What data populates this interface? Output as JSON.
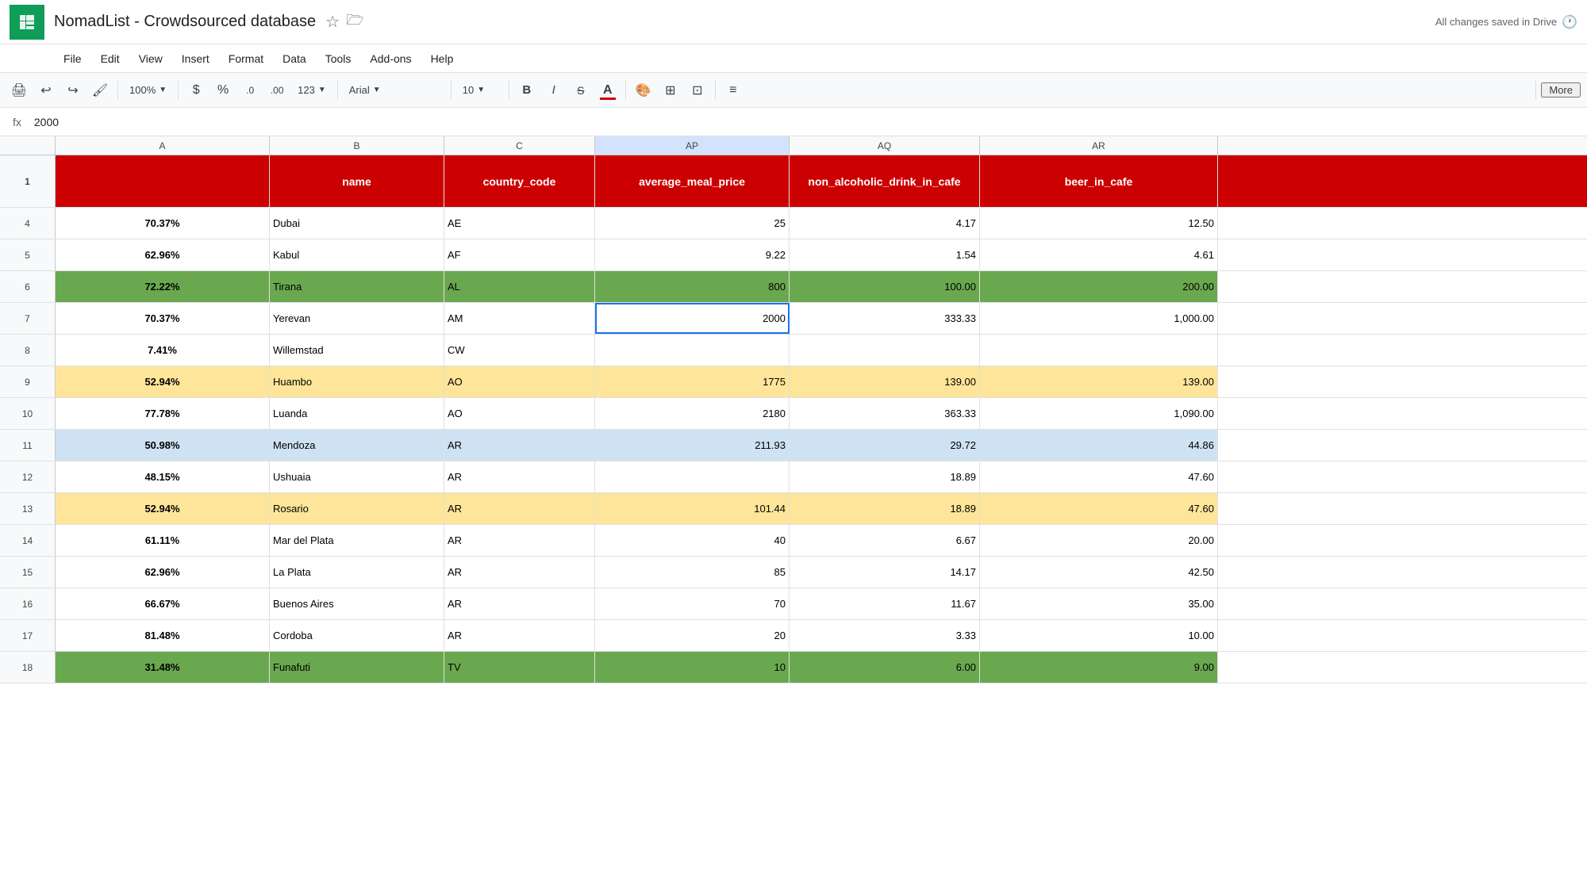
{
  "app": {
    "icon_label": "sheets-icon",
    "title": "NomadList - Crowdsourced database",
    "star_icon": "★",
    "folder_icon": "🗀",
    "autosave": "All changes saved in Drive"
  },
  "menu": {
    "items": [
      "File",
      "Edit",
      "View",
      "Insert",
      "Format",
      "Data",
      "Tools",
      "Add-ons",
      "Help"
    ]
  },
  "toolbar": {
    "zoom": "100%",
    "currency": "$",
    "percent": "%",
    "decimal_less": ".0",
    "decimal_more": ".00",
    "number_format": "123",
    "font": "Arial",
    "font_size": "10",
    "more_label": "More"
  },
  "formula_bar": {
    "fx": "fx",
    "value": "2000"
  },
  "columns": {
    "headers": [
      "A",
      "B",
      "C",
      "AP",
      "AQ",
      "AR"
    ],
    "widths": [
      270,
      220,
      190,
      245,
      240,
      300
    ],
    "col_A_label": "A",
    "col_B_label": "B",
    "col_C_label": "C",
    "col_AP_label": "AP",
    "col_AQ_label": "AQ",
    "col_AR_label": "AR"
  },
  "header_row": {
    "row_num": "1",
    "col_b": "name",
    "col_c": "country_code",
    "col_ap": "average_meal_price",
    "col_aq": "non_alcoholic_drink_in_cafe",
    "col_ar": "beer_in_cafe"
  },
  "rows": [
    {
      "num": "4",
      "col_a": "70.37%",
      "col_b": "Dubai",
      "col_c": "AE",
      "col_ap": "25",
      "col_aq": "4.17",
      "col_ar": "12.50",
      "row_color": "white"
    },
    {
      "num": "5",
      "col_a": "62.96%",
      "col_b": "Kabul",
      "col_c": "AF",
      "col_ap": "9.22",
      "col_aq": "1.54",
      "col_ar": "4.61",
      "row_color": "white"
    },
    {
      "num": "6",
      "col_a": "72.22%",
      "col_b": "Tirana",
      "col_c": "AL",
      "col_ap": "800",
      "col_aq": "100.00",
      "col_ar": "200.00",
      "row_color": "green"
    },
    {
      "num": "7",
      "col_a": "70.37%",
      "col_b": "Yerevan",
      "col_c": "AM",
      "col_ap": "2000",
      "col_aq": "333.33",
      "col_ar": "1,000.00",
      "row_color": "white",
      "active_ap": true
    },
    {
      "num": "8",
      "col_a": "7.41%",
      "col_b": "Willemstad",
      "col_c": "CW",
      "col_ap": "",
      "col_aq": "",
      "col_ar": "",
      "row_color": "white"
    },
    {
      "num": "9",
      "col_a": "52.94%",
      "col_b": "Huambo",
      "col_c": "AO",
      "col_ap": "1775",
      "col_aq": "139.00",
      "col_ar": "139.00",
      "row_color": "yellow"
    },
    {
      "num": "10",
      "col_a": "77.78%",
      "col_b": "Luanda",
      "col_c": "AO",
      "col_ap": "2180",
      "col_aq": "363.33",
      "col_ar": "1,090.00",
      "row_color": "white"
    },
    {
      "num": "11",
      "col_a": "50.98%",
      "col_b": "Mendoza",
      "col_c": "AR",
      "col_ap": "211.93",
      "col_aq": "29.72",
      "col_ar": "44.86",
      "row_color": "blue"
    },
    {
      "num": "12",
      "col_a": "48.15%",
      "col_b": "Ushuaia",
      "col_c": "AR",
      "col_ap": "",
      "col_aq": "18.89",
      "col_ar": "47.60",
      "row_color": "white"
    },
    {
      "num": "13",
      "col_a": "52.94%",
      "col_b": "Rosario",
      "col_c": "AR",
      "col_ap": "101.44",
      "col_aq": "18.89",
      "col_ar": "47.60",
      "row_color": "yellow"
    },
    {
      "num": "14",
      "col_a": "61.11%",
      "col_b": "Mar del Plata",
      "col_c": "AR",
      "col_ap": "40",
      "col_aq": "6.67",
      "col_ar": "20.00",
      "row_color": "white"
    },
    {
      "num": "15",
      "col_a": "62.96%",
      "col_b": "La Plata",
      "col_c": "AR",
      "col_ap": "85",
      "col_aq": "14.17",
      "col_ar": "42.50",
      "row_color": "white"
    },
    {
      "num": "16",
      "col_a": "66.67%",
      "col_b": "Buenos Aires",
      "col_c": "AR",
      "col_ap": "70",
      "col_aq": "11.67",
      "col_ar": "35.00",
      "row_color": "white"
    },
    {
      "num": "17",
      "col_a": "81.48%",
      "col_b": "Cordoba",
      "col_c": "AR",
      "col_ap": "20",
      "col_aq": "3.33",
      "col_ar": "10.00",
      "row_color": "white"
    },
    {
      "num": "18",
      "col_a": "31.48%",
      "col_b": "Funafuti",
      "col_c": "TV",
      "col_ap": "10",
      "col_aq": "6.00",
      "col_ar": "9.00",
      "row_color": "green"
    }
  ]
}
